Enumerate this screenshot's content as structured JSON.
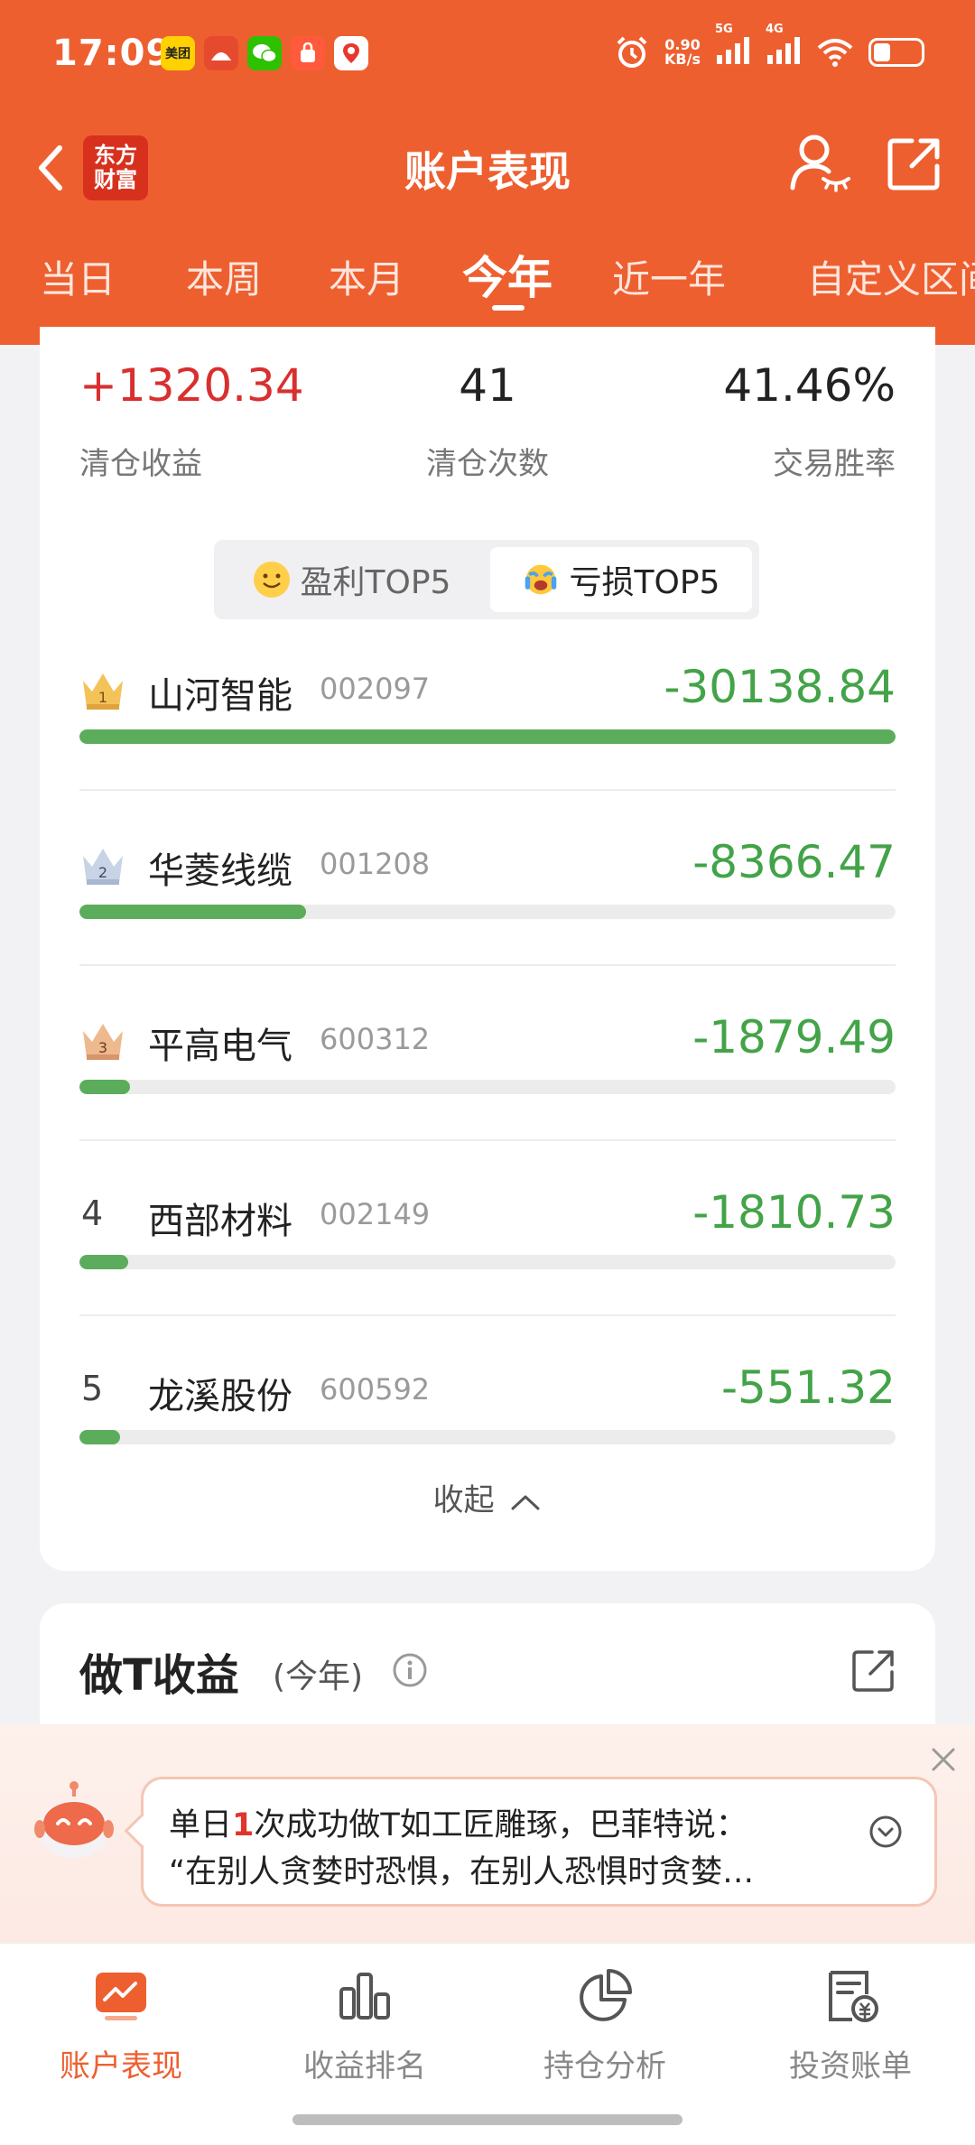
{
  "status_bar": {
    "time": "17:09",
    "apps": [
      "美团",
      "",
      "",
      "",
      ""
    ],
    "net_speed_value": "0.90",
    "net_speed_unit": "KB/s",
    "signal_1": "5G",
    "signal_2": "4G"
  },
  "header": {
    "logo_line1": "东方",
    "logo_line2": "财富",
    "title": "账户表现"
  },
  "tabs": [
    {
      "label": "当日"
    },
    {
      "label": "本周"
    },
    {
      "label": "本月"
    },
    {
      "label": "今年",
      "active": true
    },
    {
      "label": "近一年"
    },
    {
      "label": "自定义区间"
    }
  ],
  "summary": {
    "clear_profit_value": "+1320.34",
    "clear_profit_label": "清仓收益",
    "clear_count_value": "41",
    "clear_count_label": "清仓次数",
    "win_rate_value": "41.46%",
    "win_rate_label": "交易胜率"
  },
  "toggle": {
    "profit_label": "盈利TOP5",
    "loss_label": "亏损TOP5",
    "selected": "loss"
  },
  "loss_top5": [
    {
      "rank": "1",
      "name": "山河智能",
      "code": "002097",
      "value": "-30138.84",
      "bar_fraction": 1.0
    },
    {
      "rank": "2",
      "name": "华菱线缆",
      "code": "001208",
      "value": "-8366.47",
      "bar_fraction": 0.278
    },
    {
      "rank": "3",
      "name": "平高电气",
      "code": "600312",
      "value": "-1879.49",
      "bar_fraction": 0.062
    },
    {
      "rank": "4",
      "name": "西部材料",
      "code": "002149",
      "value": "-1810.73",
      "bar_fraction": 0.06
    },
    {
      "rank": "5",
      "name": "龙溪股份",
      "code": "600592",
      "value": "-551.32",
      "bar_fraction": 0.05
    }
  ],
  "collapse_label": "收起",
  "t_section": {
    "title": "做T收益",
    "subtitle": "(今年)"
  },
  "assistant": {
    "line1_a": "单日",
    "line1_highlight": "1",
    "line1_b": "次成功做T如工匠雕琢，巴菲特说：",
    "line2": "“在别人贪婪时恐惧，在别人恐惧时贪婪…"
  },
  "bottom_nav": [
    {
      "label": "账户表现",
      "icon": "chart-trend-icon",
      "active": true
    },
    {
      "label": "收益排名",
      "icon": "bar-ranking-icon"
    },
    {
      "label": "持仓分析",
      "icon": "pie-chart-icon"
    },
    {
      "label": "投资账单",
      "icon": "bill-icon"
    }
  ],
  "colors": {
    "brand": "#ee5f30",
    "loss_green": "#43a348",
    "profit_red": "#d8302f"
  }
}
